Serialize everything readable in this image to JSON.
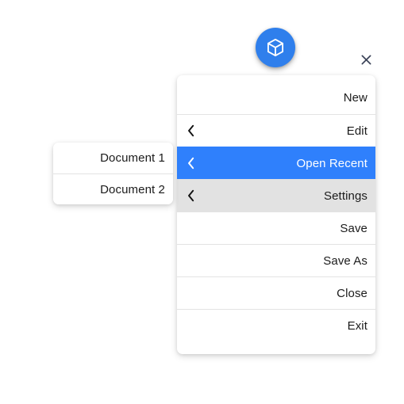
{
  "colors": {
    "accent_blue": "#2f80fc",
    "fab_blue": "#2f7fec",
    "hover_gray": "#e2e2e2",
    "separator": "#e3e3e3",
    "text": "#1b1b1b",
    "close_icon": "#3b4358",
    "page_background": "#ffffff"
  },
  "fab": {
    "icon": "cube-icon",
    "aria_label": "Open menu"
  },
  "close_button": {
    "icon": "close-icon",
    "aria_label": "Close"
  },
  "main_menu": {
    "items": [
      {
        "label": "New",
        "has_chevron": false,
        "state": "normal"
      },
      {
        "label": "Edit",
        "has_chevron": true,
        "state": "normal"
      },
      {
        "label": "Open Recent",
        "has_chevron": true,
        "state": "selected"
      },
      {
        "label": "Settings",
        "has_chevron": true,
        "state": "hovered"
      },
      {
        "label": "Save",
        "has_chevron": false,
        "state": "normal"
      },
      {
        "label": "Save As",
        "has_chevron": false,
        "state": "normal"
      },
      {
        "label": "Close",
        "has_chevron": false,
        "state": "normal"
      },
      {
        "label": "Exit",
        "has_chevron": false,
        "state": "normal"
      }
    ]
  },
  "submenu": {
    "parent_item": "Open Recent",
    "items": [
      {
        "label": "Document 1"
      },
      {
        "label": "Document 2"
      }
    ]
  }
}
